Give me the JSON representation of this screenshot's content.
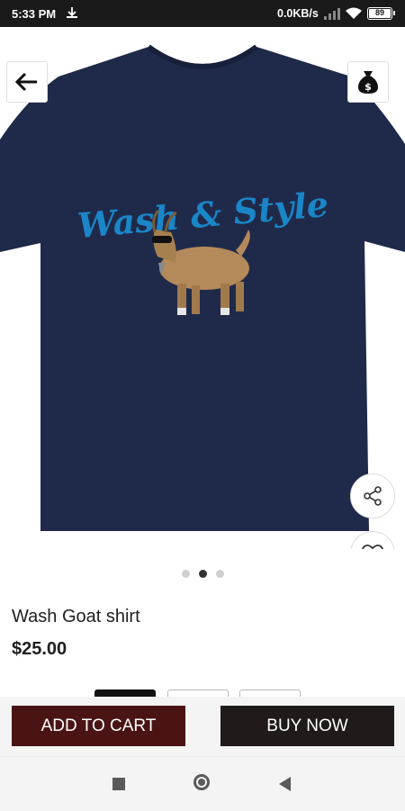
{
  "status_bar": {
    "time": "5:33 PM",
    "network_speed": "0.0KB/s",
    "battery": "89"
  },
  "product": {
    "shirt_print_text": "Wash & Style",
    "title": "Wash Goat shirt",
    "price": "$25.00",
    "image_count": 3,
    "active_image_index": 1,
    "shirt_color": "#1f2a4a",
    "print_color": "#1a86c8"
  },
  "actions": {
    "add_to_cart": "ADD TO CART",
    "buy_now": "BUY NOW"
  },
  "icons": {
    "back": "arrow-left-icon",
    "money": "money-bag-icon",
    "share": "share-icon",
    "favorite": "heart-icon"
  },
  "colors": {
    "add_to_cart_bg": "#4b1414",
    "buy_now_bg": "#201a1a"
  }
}
